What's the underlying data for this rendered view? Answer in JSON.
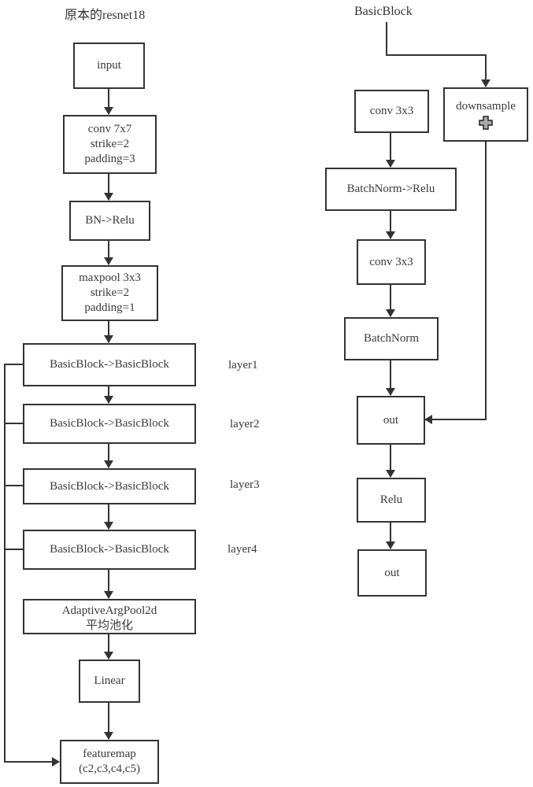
{
  "left": {
    "title": "原本的resnet18",
    "nodes": {
      "input": [
        "input"
      ],
      "conv7": [
        "conv 7x7",
        "strike=2",
        "padding=3"
      ],
      "bn": [
        "BN->Relu"
      ],
      "maxpool": [
        "maxpool 3x3",
        "strike=2",
        "padding=1"
      ],
      "layer1": [
        "BasicBlock->BasicBlock"
      ],
      "layer2": [
        "BasicBlock->BasicBlock"
      ],
      "layer3": [
        "BasicBlock->BasicBlock"
      ],
      "layer4": [
        "BasicBlock->BasicBlock"
      ],
      "avgpool": [
        "AdaptiveArgPool2d",
        "平均池化"
      ],
      "linear": [
        "Linear"
      ],
      "featuremap": [
        "featuremap",
        "(c2,c3,c4,c5)"
      ]
    },
    "layer_labels": [
      "layer1",
      "layer2",
      "layer3",
      "layer4"
    ]
  },
  "right": {
    "title": "BasicBlock",
    "nodes": {
      "conv1": [
        "conv 3x3"
      ],
      "bnrelu": [
        "BatchNorm->Relu"
      ],
      "conv2": [
        "conv 3x3"
      ],
      "bn": [
        "BatchNorm"
      ],
      "out1": [
        "out"
      ],
      "relu": [
        "Relu"
      ],
      "out2": [
        "out"
      ],
      "downsample": [
        "downsample"
      ]
    },
    "downsample_icon": "plus-icon"
  }
}
